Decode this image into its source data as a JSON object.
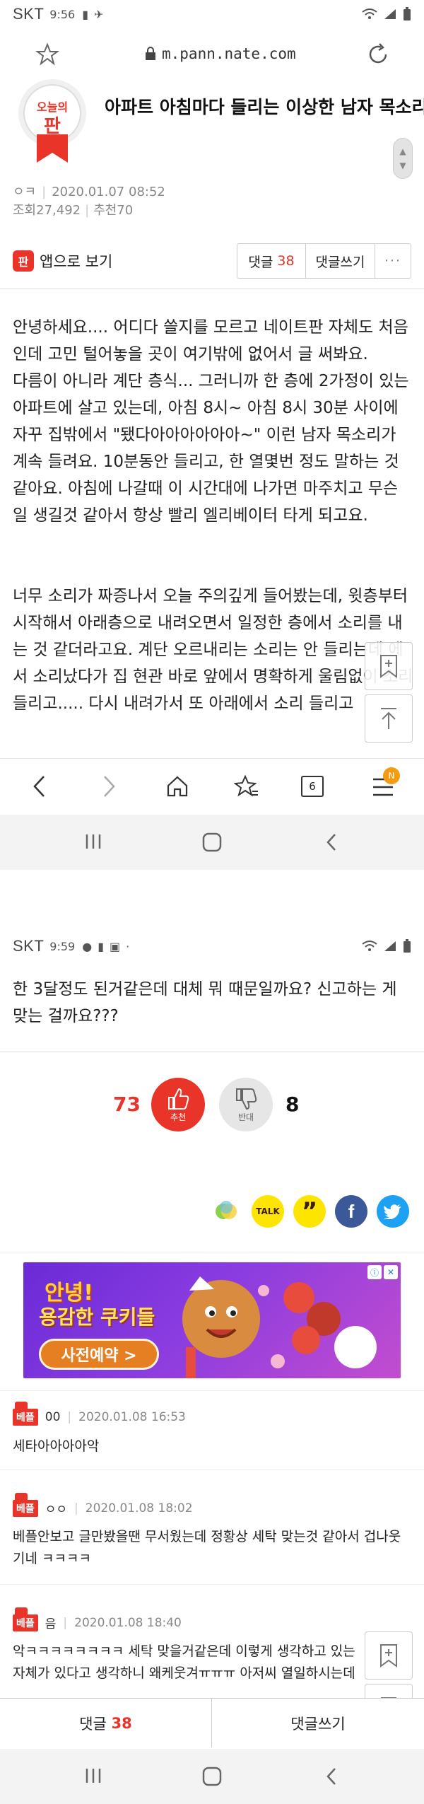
{
  "status_top": {
    "carrier": "SKT",
    "time": "9:56"
  },
  "urlbar": {
    "url": "m.pann.nate.com"
  },
  "badge": {
    "line1": "오늘의",
    "line2": "판"
  },
  "article": {
    "title": "아파트 아침마다 들리는 이상한 남자 목소리",
    "author": "ㅇㅋ",
    "date": "2020.01.07 08:52",
    "views": "조회27,492",
    "recommend": "추천70"
  },
  "actions": {
    "app_view": "앱으로 보기",
    "comments_label": "댓글",
    "comments_count": "38",
    "write_comment": "댓글쓰기",
    "more": "···"
  },
  "body": {
    "paragraph1": "안녕하세요.... 어디다 쓸지를 모르고 네이트판 자체도 처음인데 고민 털어놓을 곳이 여기밖에 없어서 글 써봐요.\n다름이 아니라 계단 층식... 그러니까 한 층에 2가정이 있는 아파트에 살고 있는데, 아침 8시~ 아침 8시 30분 사이에 자꾸 집밖에서 \"됐다아아아아아아~\" 이런 남자 목소리가 계속 들려요. 10분동안 들리고, 한 열몇번 정도 말하는 것 같아요. 아침에 나갈때 이 시간대에 나가면 마주치고 무슨 일 생길것 같아서 항상 빨리 엘리베이터 타게 되고요.",
    "paragraph2": "너무 소리가 짜증나서 오늘 주의깊게 들어봤는데, 윗층부터 시작해서 아래층으로 내려오면서 일정한 층에서 소리를 내는 것 같더라고요. 계단 오르내리는 소리는 안 들리는데 에서 소리났다가 집 현관 바로 앞에서 명확하게 울림없이 소리 들리고..... 다시 내려가서 또 아래에서 소리 들리고",
    "paragraph3": "한 3달정도 된거같은데 대체 뭐 때문일까요? 신고하는 게 맞는 걸까요???"
  },
  "toolbar": {
    "tabs_count": "6",
    "menu_badge": "N"
  },
  "status_mid": {
    "carrier": "SKT",
    "time": "9:59"
  },
  "votes": {
    "up_count": "73",
    "up_label": "추천",
    "down_label": "반대",
    "down_count": "8"
  },
  "share": {
    "kakao_talk": "TALK",
    "kakao_story": "”",
    "facebook": "f"
  },
  "ad": {
    "title1": "안녕!",
    "title2": "용감한 쿠키들",
    "button": "사전예약 >"
  },
  "comments": [
    {
      "best": "베플",
      "nick": "00",
      "date": "2020.01.08 16:53",
      "text": "세타아아아아악"
    },
    {
      "best": "베플",
      "nick": "ㅇㅇ",
      "date": "2020.01.08 18:02",
      "text": "베플안보고 글만봤을땐 무서웠는데 정황상 세탁 맞는것 같아서 겁나웃기네 ㅋㅋㅋㅋ"
    },
    {
      "best": "베플",
      "nick": "음",
      "date": "2020.01.08 18:40",
      "text": "악ㅋㅋㅋㅋㅋㅋㅋㅋ 세탁 맞을거같은데 이렇게 생각하고 있는 자체가 있다고 생각하니 왜케웃겨ㅠㅠㅠ 아저씨 열일하시는데 뜬금 불쌍ㅠㅠ"
    }
  ],
  "bottom_bar": {
    "comments_label": "댓글",
    "comments_count": "38",
    "write_comment": "댓글쓰기"
  },
  "colors": {
    "accent": "#e9342a",
    "facebook": "#3b5998",
    "twitter": "#1da1f2",
    "kakao": "#fee500"
  }
}
